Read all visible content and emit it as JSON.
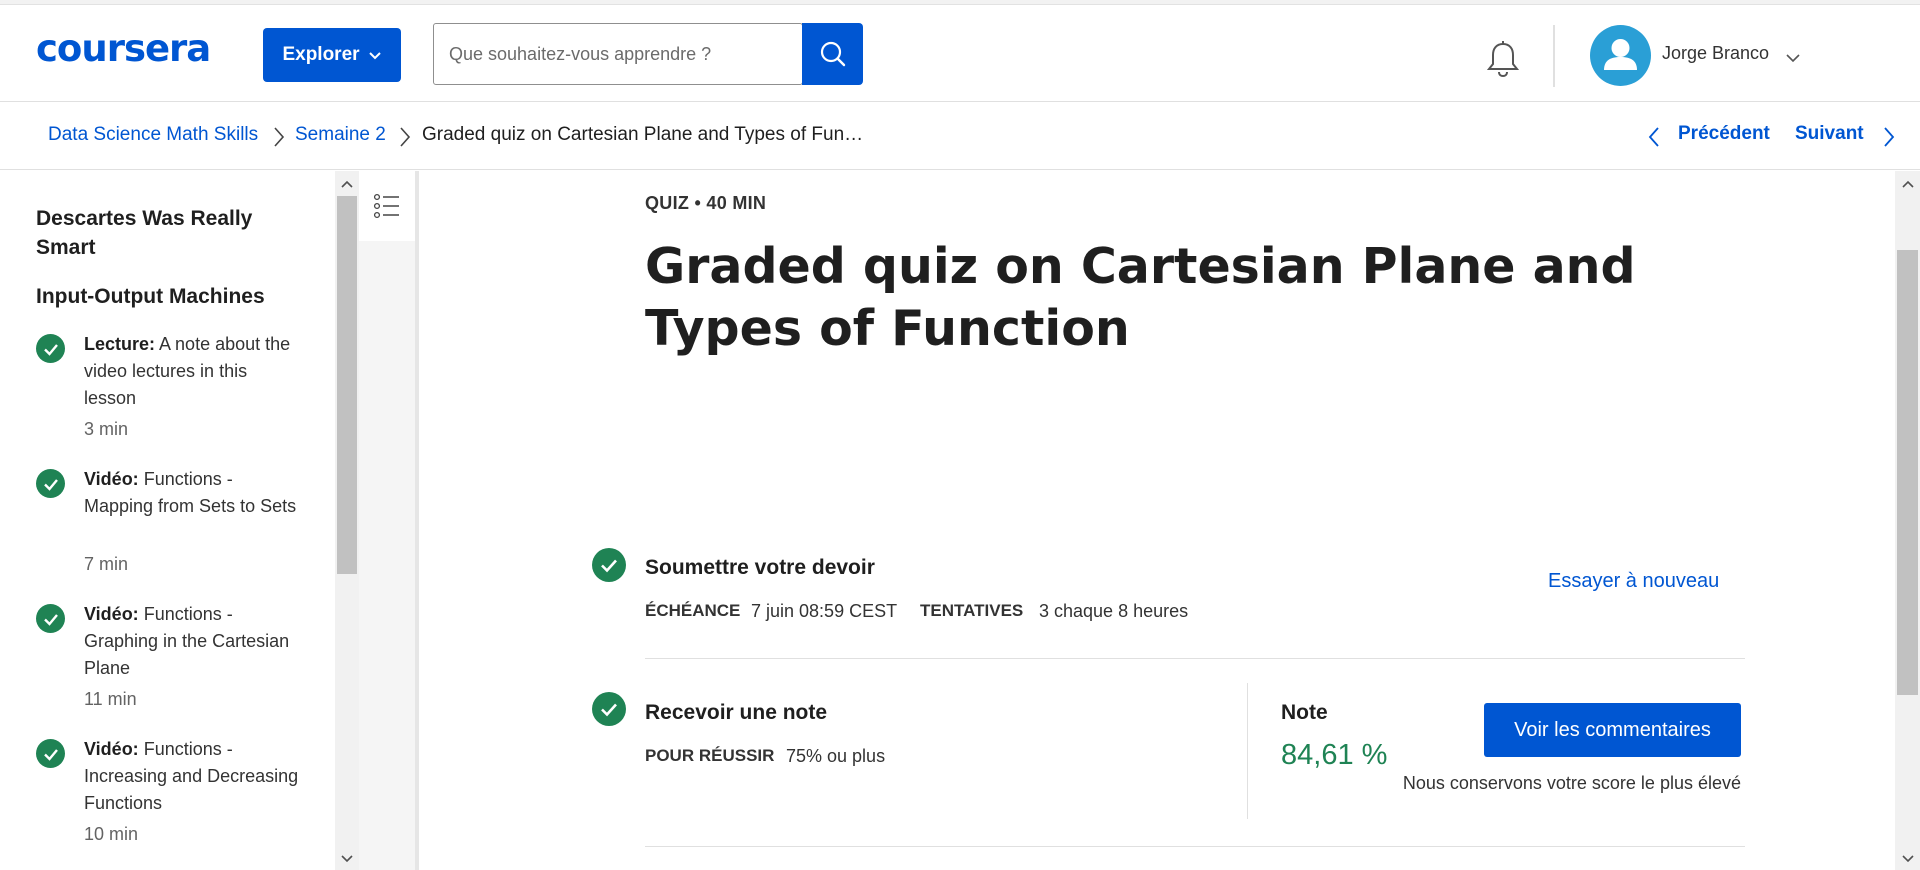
{
  "header": {
    "logo": "coursera",
    "explore_label": "Explorer",
    "search_placeholder": "Que souhaitez-vous apprendre ?",
    "user_name": "Jorge Branco"
  },
  "breadcrumb": {
    "items": [
      "Data Science Math Skills",
      "Semaine 2",
      "Graded quiz on Cartesian Plane and Types of Fun…"
    ],
    "prev_label": "Précédent",
    "next_label": "Suivant"
  },
  "sidebar": {
    "sections": [
      "Descartes Was Really Smart",
      "Input-Output Machines"
    ],
    "items": [
      {
        "type": "Lecture:",
        "title": "A note about the video lectures in this lesson",
        "time": "3 min"
      },
      {
        "type": "Vidéo:",
        "title": "Functions - Mapping from Sets to Sets",
        "time": "7 min"
      },
      {
        "type": "Vidéo:",
        "title": "Functions - Graphing in the Cartesian Plane",
        "time": "11 min"
      },
      {
        "type": "Vidéo:",
        "title": "Functions - Increasing and Decreasing Functions",
        "time": "10 min"
      }
    ]
  },
  "main": {
    "kicker": "QUIZ • 40 MIN",
    "title": "Graded quiz on Cartesian Plane and Types of Function",
    "submit": {
      "title": "Soumettre votre devoir",
      "deadline_label": "ÉCHÉANCE",
      "deadline_value": "7 juin 08:59 CEST",
      "attempts_label": "TENTATIVES",
      "attempts_value": "3 chaque 8 heures",
      "retry_label": "Essayer à nouveau"
    },
    "grade": {
      "title": "Recevoir une note",
      "pass_label": "POUR RÉUSSIR",
      "pass_value": "75% ou plus",
      "note_label": "Note",
      "note_value": "84,61 %",
      "feedback_label": "Voir les commentaires",
      "keep_note": "Nous conservons votre score le plus élevé"
    }
  },
  "colors": {
    "brand": "#0056d2",
    "success": "#1f8354",
    "avatar": "#2a9fd6"
  }
}
